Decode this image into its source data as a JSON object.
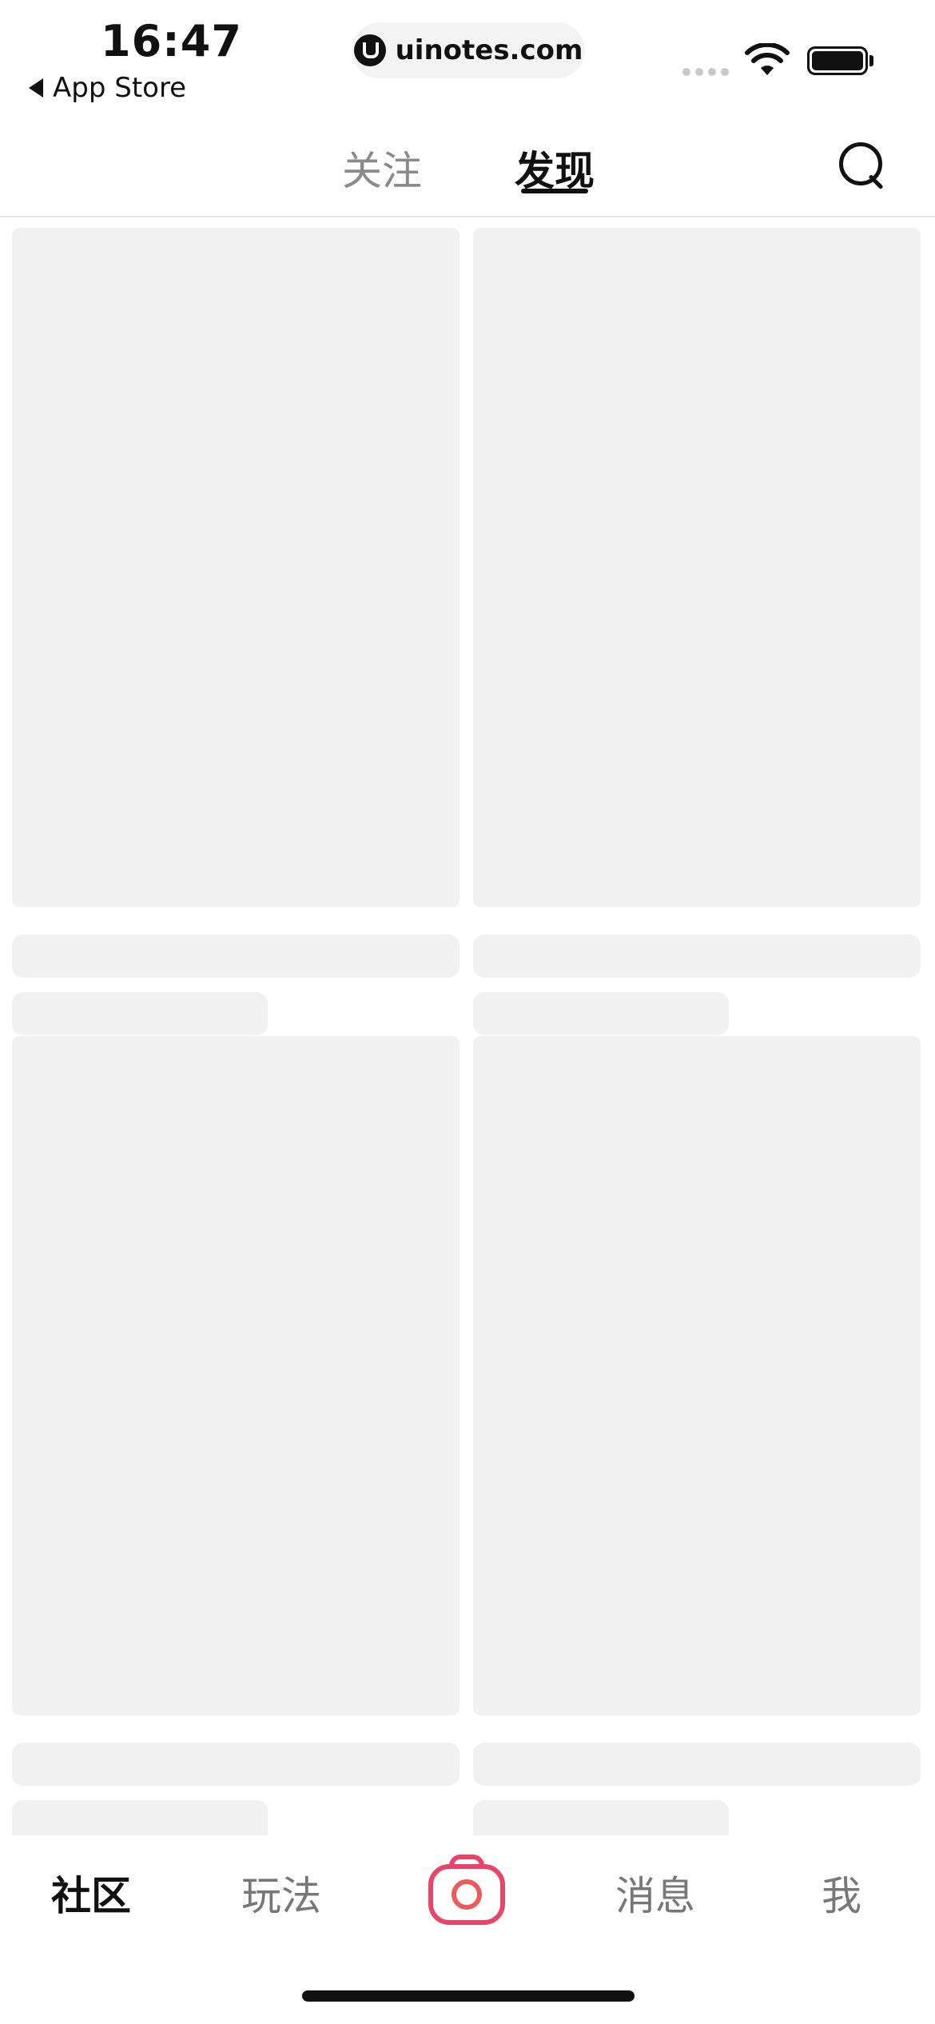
{
  "status_bar": {
    "time": "16:47",
    "back_app_label": "App Store",
    "url": "uinotes.com"
  },
  "header": {
    "tabs": [
      {
        "label": "关注",
        "active": false
      },
      {
        "label": "发现",
        "active": true
      }
    ],
    "search_icon": "search-icon"
  },
  "feed": {
    "state": "loading-skeleton",
    "skeleton_color": "#f1f1f1"
  },
  "tabbar": {
    "items": [
      {
        "label": "社区",
        "active": true
      },
      {
        "label": "玩法",
        "active": false
      },
      {
        "label": "消息",
        "active": false
      },
      {
        "label": "我",
        "active": false
      }
    ],
    "center_icon": "camera-icon",
    "accent_color": "#e8456b"
  }
}
